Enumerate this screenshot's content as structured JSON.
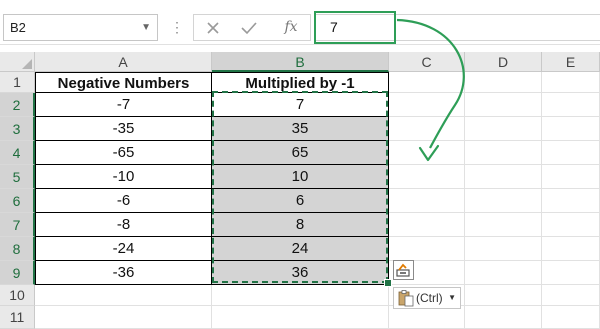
{
  "formula_bar": {
    "name_box": "B2",
    "formula_value": "7",
    "fx_label": "fx"
  },
  "columns": [
    "A",
    "B",
    "C",
    "D",
    "E"
  ],
  "rows": [
    "1",
    "2",
    "3",
    "4",
    "5",
    "6",
    "7",
    "8",
    "9",
    "10",
    "11"
  ],
  "sheet": {
    "header_a": "Negative Numbers",
    "header_b": "Multiplied by -1",
    "data": [
      {
        "a": "-7",
        "b": "7"
      },
      {
        "a": "-35",
        "b": "35"
      },
      {
        "a": "-65",
        "b": "65"
      },
      {
        "a": "-10",
        "b": "10"
      },
      {
        "a": "-6",
        "b": "6"
      },
      {
        "a": "-8",
        "b": "8"
      },
      {
        "a": "-24",
        "b": "24"
      },
      {
        "a": "-36",
        "b": "36"
      }
    ]
  },
  "paste_options": {
    "label": "(Ctrl)"
  },
  "colors": {
    "accent": "#217346",
    "highlight_green": "#2e9e57",
    "selected_fill": "#d4d4d4"
  }
}
